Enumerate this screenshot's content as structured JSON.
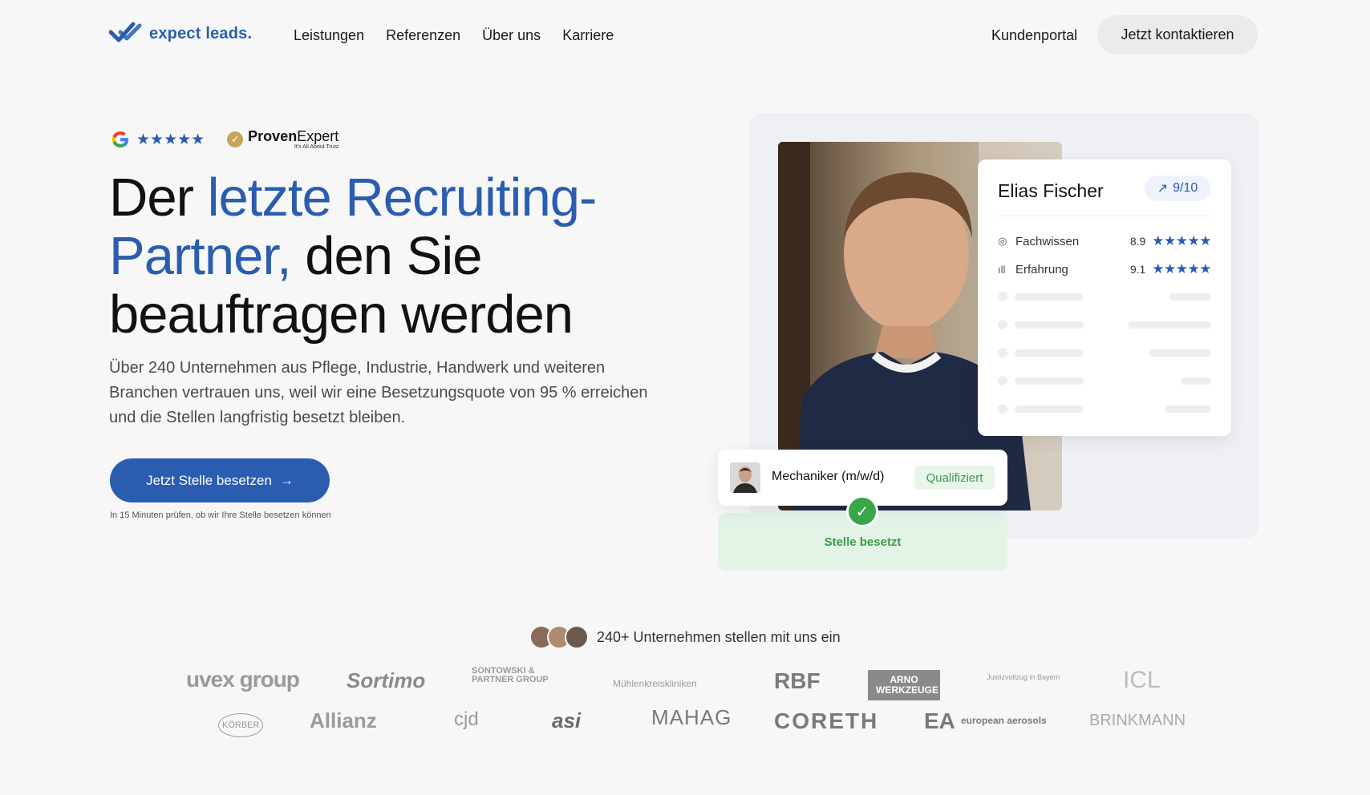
{
  "header": {
    "logo_text": "expect leads.",
    "nav": [
      "Leistungen",
      "Referenzen",
      "Über uns",
      "Karriere"
    ],
    "portal_label": "Kundenportal",
    "contact_label": "Jetzt kontaktieren"
  },
  "ratings": {
    "google_stars": "★★★★★",
    "provenexpert_name_bold": "Proven",
    "provenexpert_name_light": "Expert",
    "provenexpert_tagline": "It's All About Trust"
  },
  "hero": {
    "headline_part1": "Der ",
    "headline_blue": "letzte Recruiting-Partner,",
    "headline_part2": " den Sie beauftragen werden",
    "subtext": "Über 240 Unternehmen aus Pflege, Industrie, Handwerk und weiteren Branchen vertrauen uns, weil wir eine Besetzungsquote von 95 % erreichen und die Stellen langfristig besetzt bleiben.",
    "cta_label": "Jetzt Stelle besetzen",
    "cta_note": "In 15 Minuten prüfen, ob wir Ihre Stelle besetzen können"
  },
  "candidate": {
    "name": "Elias Fischer",
    "score": "9/10",
    "metrics": [
      {
        "label": "Fachwissen",
        "value": "8.9",
        "stars": "★★★★★"
      },
      {
        "label": "Erfahrung",
        "value": "9.1",
        "stars": "★★★★★"
      }
    ]
  },
  "job": {
    "title": "Mechaniker (m/w/d)",
    "badge": "Qualifiziert",
    "status": "Stelle besetzt"
  },
  "social_proof": {
    "text": "240+ Unternehmen stellen mit uns ein"
  },
  "logos": {
    "row1": [
      "uvex group",
      "Sortimo",
      "SONTOWSKI & PARTNER GROUP",
      "Mühlenkreiskliniken",
      "RBF",
      "ARNO WERKZEUGE",
      "Justizvollzug in Bayern",
      "ICL"
    ],
    "row2": [
      "KÖRBER",
      "Allianz",
      "cjd",
      "asi",
      "MAHAG",
      "CORETH",
      "european aerosols",
      "BRINKMANN"
    ]
  },
  "colors": {
    "brand_blue": "#2a5db0",
    "success_green": "#3aa64a",
    "background": "#f7f7f8"
  }
}
